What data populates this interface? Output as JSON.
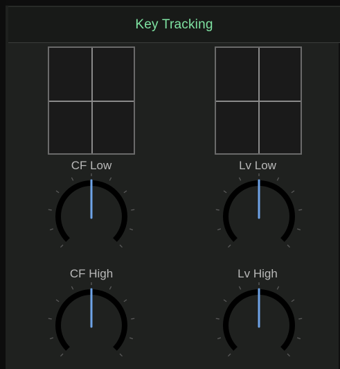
{
  "header": {
    "title": "Key Tracking"
  },
  "pads": [
    {
      "name": "left-xy-pad"
    },
    {
      "name": "right-xy-pad"
    }
  ],
  "knobs": [
    {
      "id": "cf-low",
      "label": "CF Low",
      "value": 0.5
    },
    {
      "id": "lv-low",
      "label": "Lv Low",
      "value": 0.5
    },
    {
      "id": "cf-high",
      "label": "CF High",
      "value": 0.5
    },
    {
      "id": "lv-high",
      "label": "Lv High",
      "value": 0.5
    }
  ],
  "colors": {
    "accent": "#7fe3a2",
    "indicator": "#6fa4e8",
    "arc": "#000000",
    "tick": "#5a5a5a"
  }
}
